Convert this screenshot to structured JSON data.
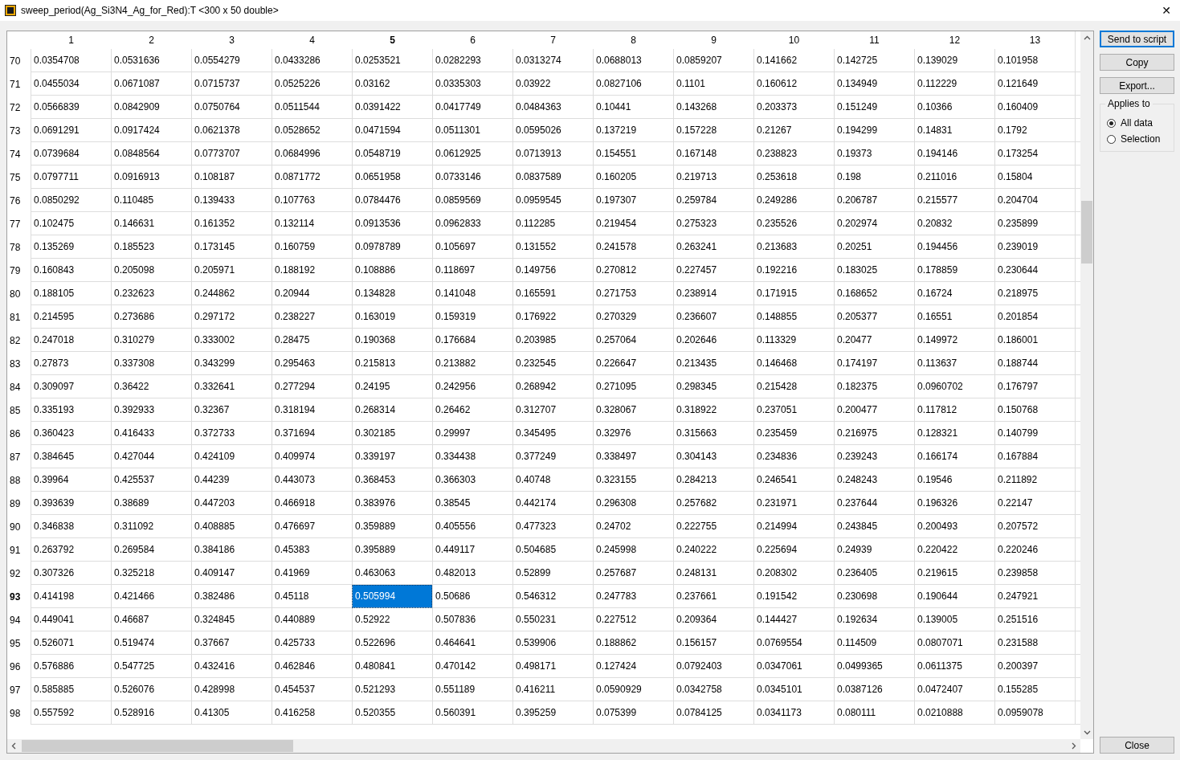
{
  "window": {
    "title": "sweep_period(Ag_Si3N4_Ag_for_Red):T <300 x 50 double>",
    "close": "✕"
  },
  "table": {
    "columns": [
      {
        "label": "1",
        "selected": false
      },
      {
        "label": "2",
        "selected": false
      },
      {
        "label": "3",
        "selected": false
      },
      {
        "label": "4",
        "selected": false
      },
      {
        "label": "5",
        "selected": true
      },
      {
        "label": "6",
        "selected": false
      },
      {
        "label": "7",
        "selected": false
      },
      {
        "label": "8",
        "selected": false
      },
      {
        "label": "9",
        "selected": false
      },
      {
        "label": "10",
        "selected": false
      },
      {
        "label": "11",
        "selected": false
      },
      {
        "label": "12",
        "selected": false
      },
      {
        "label": "13",
        "selected": false
      }
    ],
    "rows": [
      {
        "label": "70",
        "selected": false,
        "cells": [
          "0.0354708",
          "0.0531636",
          "0.0554279",
          "0.0433286",
          "0.0253521",
          "0.0282293",
          "0.0313274",
          "0.0688013",
          "0.0859207",
          "0.141662",
          "0.142725",
          "0.139029",
          "0.101958"
        ]
      },
      {
        "label": "71",
        "selected": false,
        "cells": [
          "0.0455034",
          "0.0671087",
          "0.0715737",
          "0.0525226",
          "0.03162",
          "0.0335303",
          "0.03922",
          "0.0827106",
          "0.1101",
          "0.160612",
          "0.134949",
          "0.112229",
          "0.121649"
        ]
      },
      {
        "label": "72",
        "selected": false,
        "cells": [
          "0.0566839",
          "0.0842909",
          "0.0750764",
          "0.0511544",
          "0.0391422",
          "0.0417749",
          "0.0484363",
          "0.10441",
          "0.143268",
          "0.203373",
          "0.151249",
          "0.10366",
          "0.160409"
        ]
      },
      {
        "label": "73",
        "selected": false,
        "cells": [
          "0.0691291",
          "0.0917424",
          "0.0621378",
          "0.0528652",
          "0.0471594",
          "0.0511301",
          "0.0595026",
          "0.137219",
          "0.157228",
          "0.21267",
          "0.194299",
          "0.14831",
          "0.1792"
        ]
      },
      {
        "label": "74",
        "selected": false,
        "cells": [
          "0.0739684",
          "0.0848564",
          "0.0773707",
          "0.0684996",
          "0.0548719",
          "0.0612925",
          "0.0713913",
          "0.154551",
          "0.167148",
          "0.238823",
          "0.19373",
          "0.194146",
          "0.173254"
        ]
      },
      {
        "label": "75",
        "selected": false,
        "cells": [
          "0.0797711",
          "0.0916913",
          "0.108187",
          "0.0871772",
          "0.0651958",
          "0.0733146",
          "0.0837589",
          "0.160205",
          "0.219713",
          "0.253618",
          "0.198",
          "0.211016",
          "0.15804"
        ]
      },
      {
        "label": "76",
        "selected": false,
        "cells": [
          "0.0850292",
          "0.110485",
          "0.139433",
          "0.107763",
          "0.0784476",
          "0.0859569",
          "0.0959545",
          "0.197307",
          "0.259784",
          "0.249286",
          "0.206787",
          "0.215577",
          "0.204704"
        ]
      },
      {
        "label": "77",
        "selected": false,
        "cells": [
          "0.102475",
          "0.146631",
          "0.161352",
          "0.132114",
          "0.0913536",
          "0.0962833",
          "0.112285",
          "0.219454",
          "0.275323",
          "0.235526",
          "0.202974",
          "0.20832",
          "0.235899"
        ]
      },
      {
        "label": "78",
        "selected": false,
        "cells": [
          "0.135269",
          "0.185523",
          "0.173145",
          "0.160759",
          "0.0978789",
          "0.105697",
          "0.131552",
          "0.241578",
          "0.263241",
          "0.213683",
          "0.20251",
          "0.194456",
          "0.239019"
        ]
      },
      {
        "label": "79",
        "selected": false,
        "cells": [
          "0.160843",
          "0.205098",
          "0.205971",
          "0.188192",
          "0.108886",
          "0.118697",
          "0.149756",
          "0.270812",
          "0.227457",
          "0.192216",
          "0.183025",
          "0.178859",
          "0.230644"
        ]
      },
      {
        "label": "80",
        "selected": false,
        "cells": [
          "0.188105",
          "0.232623",
          "0.244862",
          "0.20944",
          "0.134828",
          "0.141048",
          "0.165591",
          "0.271753",
          "0.238914",
          "0.171915",
          "0.168652",
          "0.16724",
          "0.218975"
        ]
      },
      {
        "label": "81",
        "selected": false,
        "cells": [
          "0.214595",
          "0.273686",
          "0.297172",
          "0.238227",
          "0.163019",
          "0.159319",
          "0.176922",
          "0.270329",
          "0.236607",
          "0.148855",
          "0.205377",
          "0.16551",
          "0.201854"
        ]
      },
      {
        "label": "82",
        "selected": false,
        "cells": [
          "0.247018",
          "0.310279",
          "0.333002",
          "0.28475",
          "0.190368",
          "0.176684",
          "0.203985",
          "0.257064",
          "0.202646",
          "0.113329",
          "0.20477",
          "0.149972",
          "0.186001"
        ]
      },
      {
        "label": "83",
        "selected": false,
        "cells": [
          "0.27873",
          "0.337308",
          "0.343299",
          "0.295463",
          "0.215813",
          "0.213882",
          "0.232545",
          "0.226647",
          "0.213435",
          "0.146468",
          "0.174197",
          "0.113637",
          "0.188744"
        ]
      },
      {
        "label": "84",
        "selected": false,
        "cells": [
          "0.309097",
          "0.36422",
          "0.332641",
          "0.277294",
          "0.24195",
          "0.242956",
          "0.268942",
          "0.271095",
          "0.298345",
          "0.215428",
          "0.182375",
          "0.0960702",
          "0.176797"
        ]
      },
      {
        "label": "85",
        "selected": false,
        "cells": [
          "0.335193",
          "0.392933",
          "0.32367",
          "0.318194",
          "0.268314",
          "0.26462",
          "0.312707",
          "0.328067",
          "0.318922",
          "0.237051",
          "0.200477",
          "0.117812",
          "0.150768"
        ]
      },
      {
        "label": "86",
        "selected": false,
        "cells": [
          "0.360423",
          "0.416433",
          "0.372733",
          "0.371694",
          "0.302185",
          "0.29997",
          "0.345495",
          "0.32976",
          "0.315663",
          "0.235459",
          "0.216975",
          "0.128321",
          "0.140799"
        ]
      },
      {
        "label": "87",
        "selected": false,
        "cells": [
          "0.384645",
          "0.427044",
          "0.424109",
          "0.409974",
          "0.339197",
          "0.334438",
          "0.377249",
          "0.338497",
          "0.304143",
          "0.234836",
          "0.239243",
          "0.166174",
          "0.167884"
        ]
      },
      {
        "label": "88",
        "selected": false,
        "cells": [
          "0.39964",
          "0.425537",
          "0.44239",
          "0.443073",
          "0.368453",
          "0.366303",
          "0.40748",
          "0.323155",
          "0.284213",
          "0.246541",
          "0.248243",
          "0.19546",
          "0.211892"
        ]
      },
      {
        "label": "89",
        "selected": false,
        "cells": [
          "0.393639",
          "0.38689",
          "0.447203",
          "0.466918",
          "0.383976",
          "0.38545",
          "0.442174",
          "0.296308",
          "0.257682",
          "0.231971",
          "0.237644",
          "0.196326",
          "0.22147"
        ]
      },
      {
        "label": "90",
        "selected": false,
        "cells": [
          "0.346838",
          "0.311092",
          "0.408885",
          "0.476697",
          "0.359889",
          "0.405556",
          "0.477323",
          "0.24702",
          "0.222755",
          "0.214994",
          "0.243845",
          "0.200493",
          "0.207572"
        ]
      },
      {
        "label": "91",
        "selected": false,
        "cells": [
          "0.263792",
          "0.269584",
          "0.384186",
          "0.45383",
          "0.395889",
          "0.449117",
          "0.504685",
          "0.245998",
          "0.240222",
          "0.225694",
          "0.24939",
          "0.220422",
          "0.220246"
        ]
      },
      {
        "label": "92",
        "selected": false,
        "cells": [
          "0.307326",
          "0.325218",
          "0.409147",
          "0.41969",
          "0.463063",
          "0.482013",
          "0.52899",
          "0.257687",
          "0.248131",
          "0.208302",
          "0.236405",
          "0.219615",
          "0.239858"
        ]
      },
      {
        "label": "93",
        "selected": true,
        "cells": [
          "0.414198",
          "0.421466",
          "0.382486",
          "0.45118",
          "0.505994",
          "0.50686",
          "0.546312",
          "0.247783",
          "0.237661",
          "0.191542",
          "0.230698",
          "0.190644",
          "0.247921"
        ]
      },
      {
        "label": "94",
        "selected": false,
        "cells": [
          "0.449041",
          "0.46687",
          "0.324845",
          "0.440889",
          "0.52922",
          "0.507836",
          "0.550231",
          "0.227512",
          "0.209364",
          "0.144427",
          "0.192634",
          "0.139005",
          "0.251516"
        ]
      },
      {
        "label": "95",
        "selected": false,
        "cells": [
          "0.526071",
          "0.519474",
          "0.37667",
          "0.425733",
          "0.522696",
          "0.464641",
          "0.539906",
          "0.188862",
          "0.156157",
          "0.0769554",
          "0.114509",
          "0.0807071",
          "0.231588"
        ]
      },
      {
        "label": "96",
        "selected": false,
        "cells": [
          "0.576886",
          "0.547725",
          "0.432416",
          "0.462846",
          "0.480841",
          "0.470142",
          "0.498171",
          "0.127424",
          "0.0792403",
          "0.0347061",
          "0.0499365",
          "0.0611375",
          "0.200397"
        ]
      },
      {
        "label": "97",
        "selected": false,
        "cells": [
          "0.585885",
          "0.526076",
          "0.428998",
          "0.454537",
          "0.521293",
          "0.551189",
          "0.416211",
          "0.0590929",
          "0.0342758",
          "0.0345101",
          "0.0387126",
          "0.0472407",
          "0.155285"
        ]
      },
      {
        "label": "98",
        "selected": false,
        "cells": [
          "0.557592",
          "0.528916",
          "0.41305",
          "0.416258",
          "0.520355",
          "0.560391",
          "0.395259",
          "0.075399",
          "0.0784125",
          "0.0341173",
          "0.080111",
          "0.0210888",
          "0.0959078"
        ]
      }
    ]
  },
  "side_panel": {
    "buttons": [
      {
        "label": "Send to script",
        "focused": true
      },
      {
        "label": "Copy",
        "focused": false
      },
      {
        "label": "Export...",
        "focused": false
      }
    ],
    "applies_to": {
      "title": "Applies to",
      "options": [
        {
          "label": "All data",
          "selected": true
        },
        {
          "label": "Selection",
          "selected": false
        }
      ]
    },
    "close_button": "Close"
  }
}
